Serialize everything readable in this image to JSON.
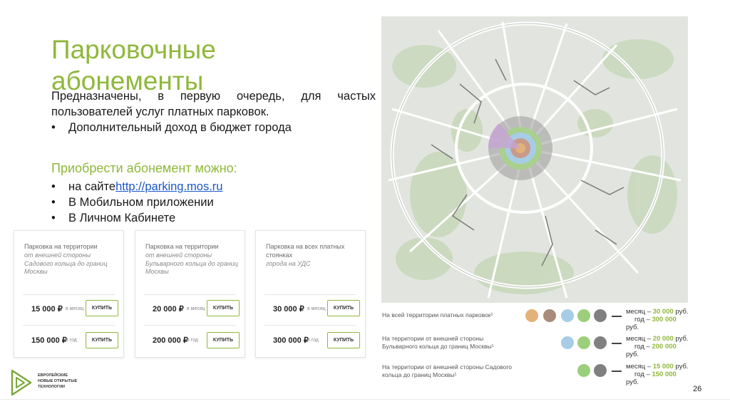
{
  "slide": {
    "title": "Парковочные абонементы",
    "description": "Предназначены, в первую очередь, для частых пользователей услуг платных парковок.",
    "bullet_1": "Дополнительный доход в бюджет города",
    "buy_heading": "Приобрести абонемент можно:",
    "buy_items": {
      "site_prefix": "на сайте ",
      "site_link": "http://parking.mos.ru",
      "app": "В Мобильном приложении",
      "cabinet": "В Личном Кабинете"
    },
    "page_number": "26"
  },
  "cards": [
    {
      "title": "Парковка на территории",
      "subtitle": "от внешней стороны Садового кольца до границ Москвы",
      "price_month": "15 000 ₽",
      "per_month": "в месяц",
      "price_year": "150 000 ₽",
      "per_year": "в год",
      "buy_label": "КУПИТЬ"
    },
    {
      "title": "Парковка на территории",
      "subtitle": "от внешней стороны Бульварного кольца до границ Москвы",
      "price_month": "20 000 ₽",
      "per_month": "в месяц",
      "price_year": "200 000 ₽",
      "per_year": "в год",
      "buy_label": "КУПИТЬ"
    },
    {
      "title": "Парковка на всех платных стоянках",
      "subtitle": "города на УДС",
      "price_month": "30 000 ₽",
      "per_month": "в месяц",
      "price_year": "300 000 ₽",
      "per_year": "в год",
      "buy_label": "КУПИТЬ"
    }
  ],
  "legend": [
    {
      "text": "На всей территории платных парковок¹",
      "month_label": "месяц –",
      "month_value": "30 000",
      "year_label": "год –",
      "year_value": "300 000",
      "currency": "руб.",
      "colors": [
        "#e3b27a",
        "#a98b79",
        "#a7cde6",
        "#9bcf7b",
        "#808080"
      ]
    },
    {
      "text": "На территории от внешней стороны Бульварного кольца до границ Москвы¹",
      "month_label": "месяц –",
      "month_value": "20 000",
      "year_label": "год –",
      "year_value": "200 000",
      "currency": "руб.",
      "colors": [
        "#a7cde6",
        "#9bcf7b",
        "#808080"
      ]
    },
    {
      "text": "На территории от внешней стороны Садового кольца до границ Москвы¹",
      "month_label": "месяц –",
      "month_value": "15 000",
      "year_label": "год –",
      "year_value": "150 000",
      "currency": "руб.",
      "colors": [
        "#9bcf7b",
        "#808080"
      ]
    }
  ],
  "logo": {
    "line1": "ЕВРОПЕЙСКИЕ",
    "line2": "НОВЫЕ ОТКРЫТЫЕ",
    "line3": "ТЕХНОЛОГИИ"
  },
  "colors": {
    "accent": "#8fb83b",
    "link": "#1a55c9"
  }
}
